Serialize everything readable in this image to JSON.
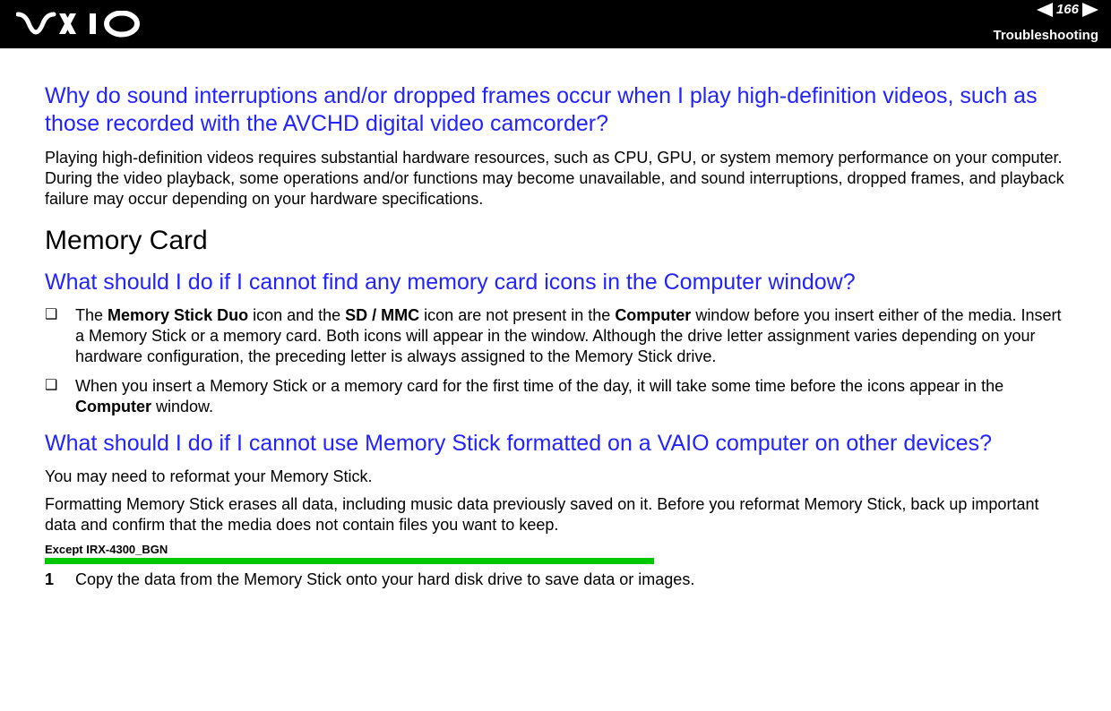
{
  "header": {
    "logo_alt": "VAIO",
    "page_number": "166",
    "section": "Troubleshooting"
  },
  "content": {
    "q1_heading": "Why do sound interruptions and/or dropped frames occur when I play high-definition videos, such as those recorded with the AVCHD digital video camcorder?",
    "q1_body": "Playing high-definition videos requires substantial hardware resources, such as CPU, GPU, or system memory performance on your computer. During the video playback, some operations and/or functions may become unavailable, and sound interruptions, dropped frames, and playback failure may occur depending on your hardware specifications.",
    "section_heading": "Memory Card",
    "q2_heading": "What should I do if I cannot find any memory card icons in the Computer window?",
    "q2_bullets": {
      "b1_pre": "The ",
      "b1_bold1": "Memory Stick Duo",
      "b1_mid1": " icon and the ",
      "b1_bold2": "SD / MMC",
      "b1_mid2": " icon are not present in the ",
      "b1_bold3": "Computer",
      "b1_post": " window before you insert either of the media. Insert a Memory Stick or a memory card. Both icons will appear in the window. Although the drive letter assignment varies depending on your hardware configuration, the preceding letter is always assigned to the Memory Stick drive.",
      "b2_pre": "When you insert a Memory Stick or a memory card for the first time of the day, it will take some time before the icons appear in the ",
      "b2_bold": "Computer",
      "b2_post": " window."
    },
    "q3_heading": "What should I do if I cannot use Memory Stick formatted on a VAIO computer on other devices?",
    "q3_p1": "You may need to reformat your Memory Stick.",
    "q3_p2": "Formatting Memory Stick erases all data, including music data previously saved on it. Before you reformat Memory Stick, back up important data and confirm that the media does not contain files you want to keep.",
    "note_label": "Except IRX-4300_BGN",
    "step1_num": "1",
    "step1_text": "Copy the data from the Memory Stick onto your hard disk drive to save data or images."
  }
}
